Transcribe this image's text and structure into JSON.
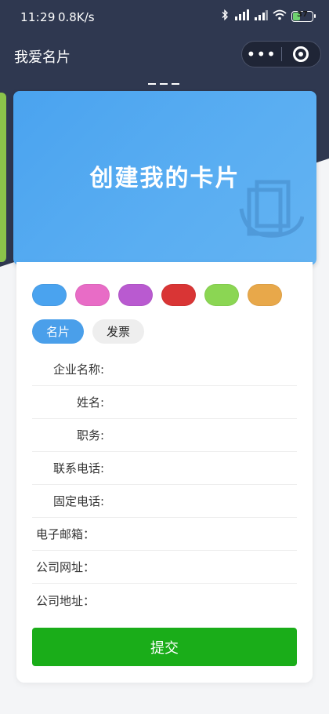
{
  "status_bar": {
    "time": "11:29",
    "speed": "0.8K/s",
    "battery": "37",
    "battery_level": 0.37
  },
  "nav": {
    "title": "我爱名片"
  },
  "hero": {
    "title": "创建我的卡片"
  },
  "colors": {
    "primary_dark": "#2f3850",
    "submit_green": "#1aad19",
    "active_tab_blue": "#4a9fea"
  },
  "color_options": [
    {
      "name": "blue",
      "hex": "#4aa3ef"
    },
    {
      "name": "pink",
      "hex": "#e86cc6"
    },
    {
      "name": "purple",
      "hex": "#b95ad0"
    },
    {
      "name": "red",
      "hex": "#d93535"
    },
    {
      "name": "green",
      "hex": "#8bd653"
    },
    {
      "name": "orange",
      "hex": "#e8a84a"
    }
  ],
  "tabs": [
    {
      "label": "名片",
      "active": true
    },
    {
      "label": "发票",
      "active": false
    }
  ],
  "fields": [
    {
      "label": "企业名称:",
      "value": "",
      "key": "company"
    },
    {
      "label": "姓名:",
      "value": "",
      "key": "name"
    },
    {
      "label": "职务:",
      "value": "",
      "key": "title"
    },
    {
      "label": "联系电话:",
      "value": "",
      "key": "phone"
    },
    {
      "label": "固定电话:",
      "value": "",
      "key": "landline"
    },
    {
      "label": "电子邮箱：",
      "value": "",
      "key": "email"
    },
    {
      "label": "公司网址：",
      "value": "",
      "key": "website"
    },
    {
      "label": "公司地址：",
      "value": "",
      "key": "address"
    }
  ],
  "submit_label": "提交"
}
